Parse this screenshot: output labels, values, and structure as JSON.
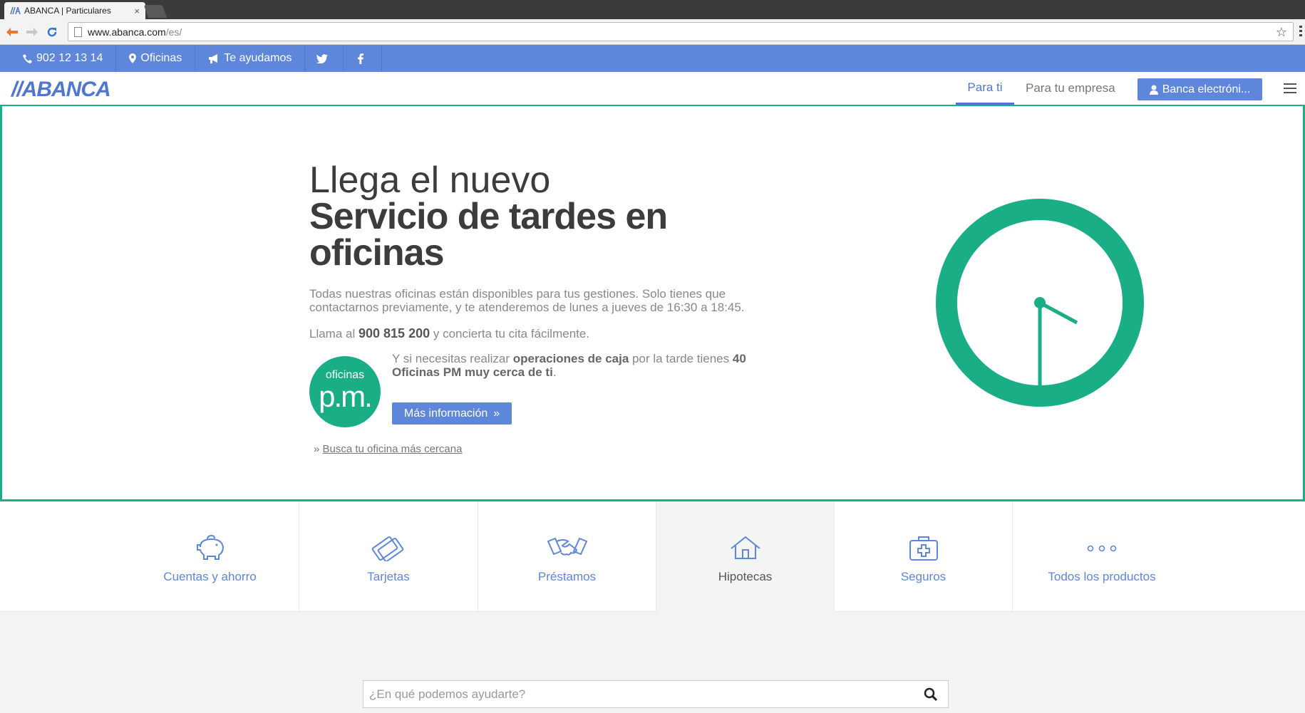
{
  "browser": {
    "tab_title": "ABANCA | Particulares",
    "tab_close": "×",
    "url_host": "www.abanca.com",
    "url_path": "/es/"
  },
  "topbar": {
    "phone": "902 12 13 14",
    "offices": "Oficinas",
    "help": "Te ayudamos"
  },
  "header": {
    "logo": "//ABANCA",
    "tab_personal": "Para ti",
    "tab_business": "Para tu empresa",
    "ebanking": "Banca electróni..."
  },
  "hero": {
    "title_light": "Llega el nuevo",
    "title_bold": "Servicio de tardes en oficinas",
    "description": "Todas nuestras oficinas están disponibles para tus gestiones. Solo tienes que contactarnos previamente, y te atenderemos de lunes a jueves de 16:30 a 18:45.",
    "call_prefix": "Llama al",
    "call_number": "900 815 200",
    "call_suffix": "y concierta tu cita fácilmente.",
    "pm_small": "oficinas",
    "pm_big": "p.m.",
    "pm_text_1": "Y si necesitas realizar",
    "pm_text_bold_1": "operaciones de caja",
    "pm_text_2": "por la tarde tienes",
    "pm_text_bold_2": "40 Oficinas PM muy cerca de ti",
    "pm_text_end": ".",
    "more_button": "Más información",
    "find_office": "Busca tu oficina más cercana"
  },
  "products": [
    {
      "label": "Cuentas y ahorro",
      "icon": "piggy-bank-icon"
    },
    {
      "label": "Tarjetas",
      "icon": "cards-icon"
    },
    {
      "label": "Préstamos",
      "icon": "handshake-icon"
    },
    {
      "label": "Hipotecas",
      "icon": "house-icon"
    },
    {
      "label": "Seguros",
      "icon": "medical-case-icon"
    },
    {
      "label": "Todos los productos",
      "icon": "dots-icon"
    }
  ],
  "search": {
    "placeholder": "¿En qué podemos ayudarte?"
  },
  "colors": {
    "brand_blue": "#5e86da",
    "brand_green": "#1aae87"
  }
}
